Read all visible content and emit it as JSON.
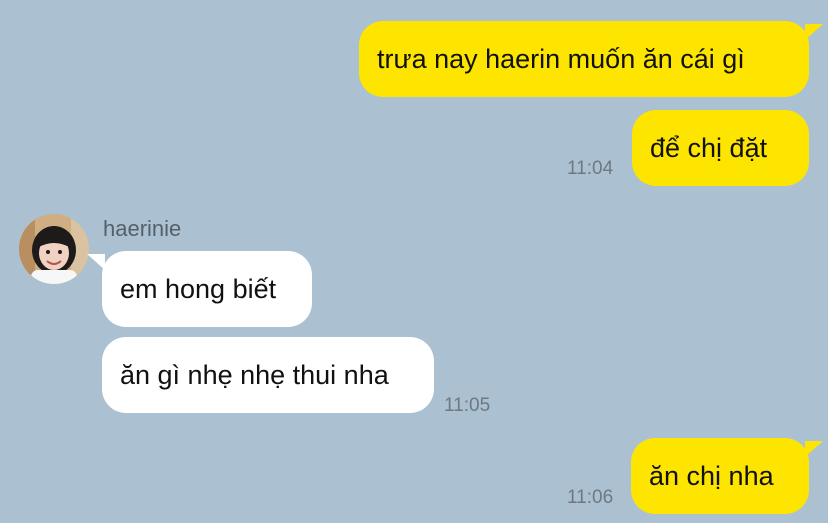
{
  "conversation": {
    "messages": [
      {
        "id": "m1",
        "direction": "outgoing",
        "text": "trưa nay haerin muốn ăn cái gì"
      },
      {
        "id": "m2",
        "direction": "outgoing",
        "text": "để chị đặt",
        "time": "11:04"
      },
      {
        "id": "m3",
        "direction": "incoming",
        "sender": "haerinie",
        "text": "em hong biết"
      },
      {
        "id": "m4",
        "direction": "incoming",
        "text": "ăn gì nhẹ nhẹ thui nha",
        "time": "11:05"
      },
      {
        "id": "m5",
        "direction": "outgoing",
        "text": "ăn chị nha",
        "time": "11:06"
      }
    ]
  },
  "colors": {
    "background": "#abc1d1",
    "outgoing_bubble": "#fee500",
    "incoming_bubble": "#ffffff",
    "timestamp": "#6f7880"
  },
  "icons": {
    "avatar": "contact-avatar-photo"
  }
}
